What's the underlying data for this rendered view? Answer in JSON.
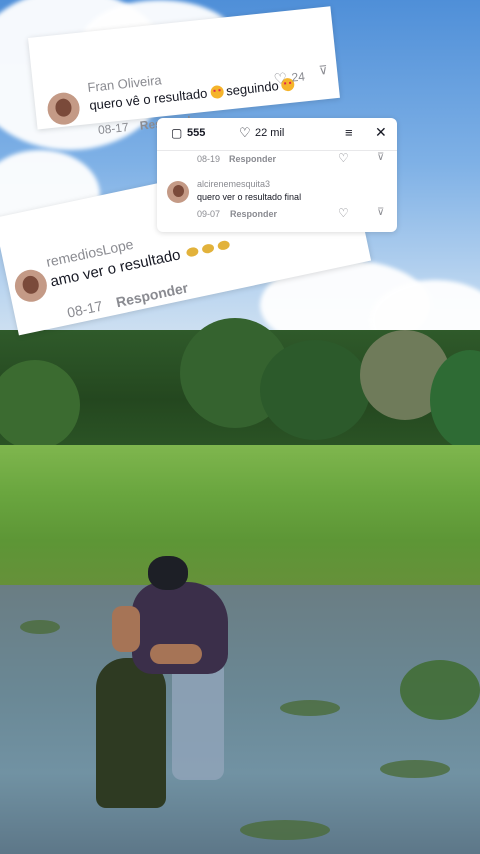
{
  "comments": {
    "fran": {
      "username": "Fran Oliveira",
      "text_a": "quero vê o resultado",
      "text_b": "seguindo",
      "date": "08-17",
      "reply": "Respond",
      "likes": "24"
    },
    "remedios": {
      "username": "remediosLope",
      "text": "amo ver o resultado",
      "date": "08-17",
      "reply": "Responder"
    },
    "panel": {
      "comments_count": "555",
      "likes_count": "22 mil",
      "prev_date": "08-19",
      "prev_reply": "Responder",
      "username": "alcirenemesquita3",
      "text": "quero ver o resultado final",
      "date": "09-07",
      "reply": "Responder"
    }
  },
  "icons": [
    "comment-icon",
    "heart-icon",
    "filter-icon",
    "close-icon",
    "dislike-icon"
  ],
  "colors": {
    "text": "#161823",
    "muted": "#8a8b91",
    "card": "#ffffff"
  }
}
